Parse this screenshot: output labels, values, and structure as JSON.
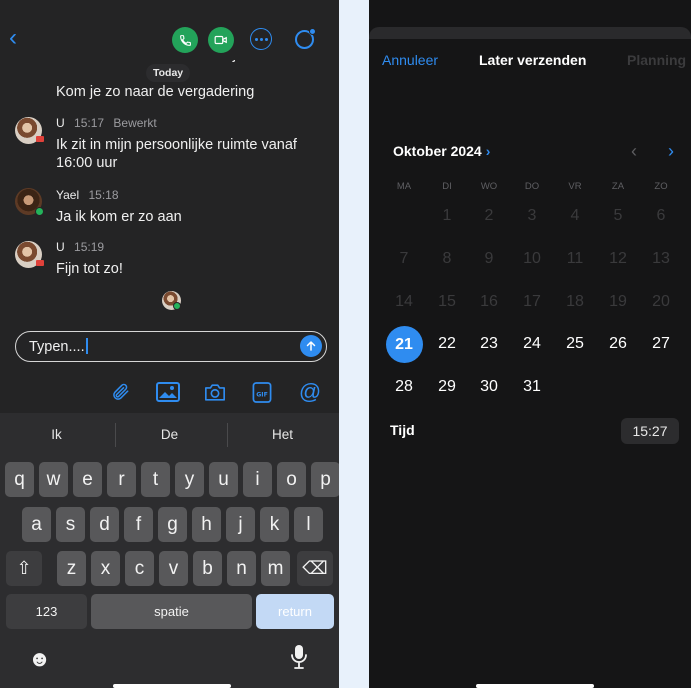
{
  "chat": {
    "cut_off_text": "Even wat voorbeeldberichtjes",
    "date_separator": "Today",
    "messages": [
      {
        "text": "Kom je zo naar de vergadering"
      },
      {
        "sender": "U",
        "time": "15:17",
        "status": "Bewerkt",
        "text_line1": "Ik zit in mijn persoonlijke ruimte vanaf",
        "text_line2": "16:00 uur"
      },
      {
        "sender": "Yael",
        "time": "15:18",
        "text": "Ja ik kom er zo aan"
      },
      {
        "sender": "U",
        "time": "15:19",
        "text": "Fijn tot zo!"
      }
    ],
    "input": {
      "value": "Typen...."
    },
    "icons": {
      "back": "chevron-left-icon",
      "call": "phone-icon",
      "video": "video-icon",
      "more": "ellipsis-icon",
      "status": "presence-ring-icon",
      "send": "arrow-up-icon",
      "attach": "paperclip-icon",
      "image": "image-icon",
      "camera": "camera-icon",
      "gif": "gif-icon",
      "mention": "at-icon"
    },
    "colors": {
      "accent": "#2f8cf0",
      "call_green": "#23a35a",
      "background": "#242425"
    }
  },
  "keyboard": {
    "suggestions": [
      "Ik",
      "De",
      "Het"
    ],
    "row1": [
      "q",
      "w",
      "e",
      "r",
      "t",
      "y",
      "u",
      "i",
      "o",
      "p"
    ],
    "row2": [
      "a",
      "s",
      "d",
      "f",
      "g",
      "h",
      "j",
      "k",
      "l"
    ],
    "row3": [
      "z",
      "x",
      "c",
      "v",
      "b",
      "n",
      "m"
    ],
    "shift_glyph": "⇧",
    "backspace_glyph": "⌫",
    "numbers_label": "123",
    "space_label": "spatie",
    "return_label": "return",
    "emoji_glyph": "☻",
    "mic_glyph": "🎙"
  },
  "schedule": {
    "cancel_label": "Annuleer",
    "title": "Later verzenden",
    "plan_label": "Planning",
    "month_label": "Oktober 2024",
    "month_chevron": "›",
    "prev_glyph": "‹",
    "next_glyph": "›",
    "weekdays": [
      "MA",
      "DI",
      "WO",
      "DO",
      "VR",
      "ZA",
      "ZO"
    ],
    "weeks": [
      [
        "",
        "1",
        "2",
        "3",
        "4",
        "5",
        "6"
      ],
      [
        "7",
        "8",
        "9",
        "10",
        "11",
        "12",
        "13"
      ],
      [
        "14",
        "15",
        "16",
        "17",
        "18",
        "19",
        "20"
      ],
      [
        "21",
        "22",
        "23",
        "24",
        "25",
        "26",
        "27"
      ],
      [
        "28",
        "29",
        "30",
        "31",
        "",
        "",
        ""
      ]
    ],
    "selected_day": "21",
    "first_available_day": 21,
    "time_label": "Tijd",
    "time_value": "15:27"
  }
}
